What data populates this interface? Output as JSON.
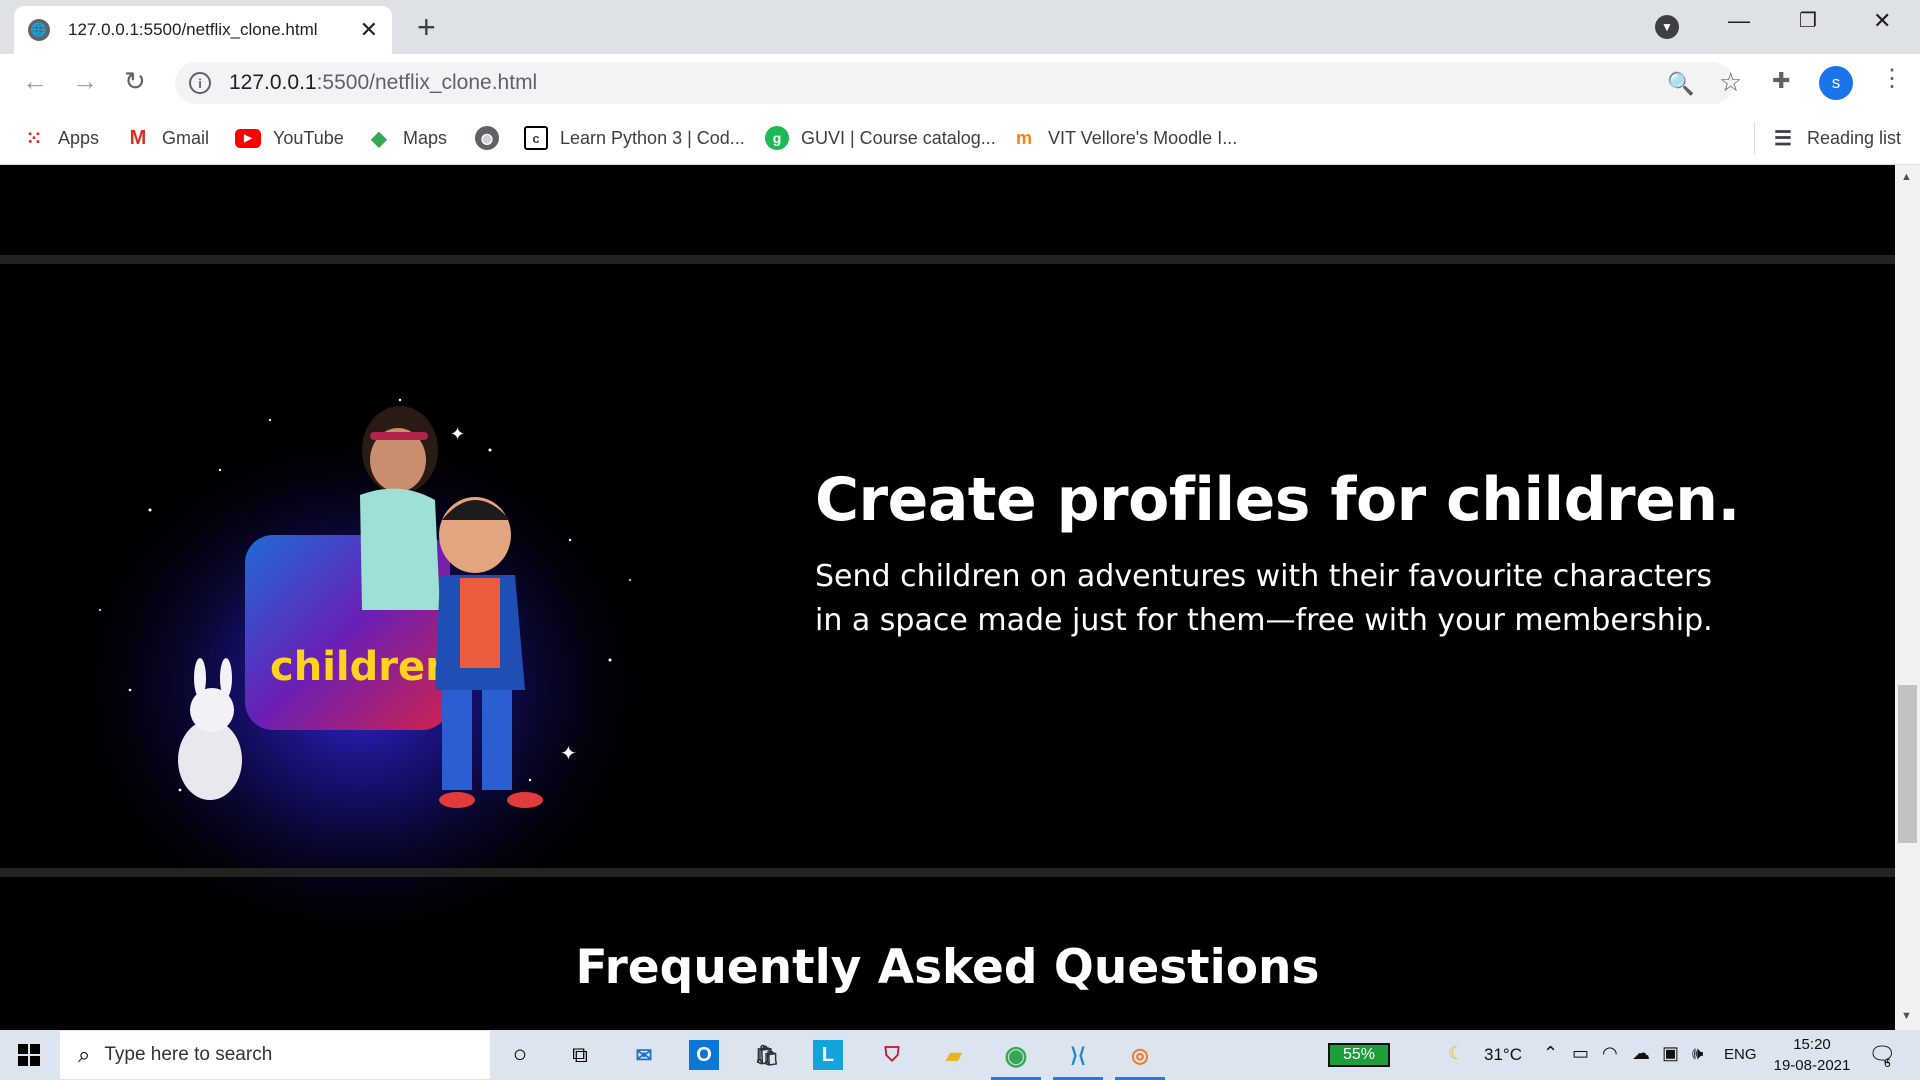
{
  "browser": {
    "tab_title": "127.0.0.1:5500/netflix_clone.html",
    "close_tab": "✕",
    "new_tab": "+",
    "url_host": "127.0.0.1",
    "url_rest": ":5500/netflix_clone.html",
    "profile_initial": "s"
  },
  "bookmarks": [
    {
      "label": "Apps",
      "icon": "apps-grid-icon"
    },
    {
      "label": "Gmail",
      "icon": "gmail-icon"
    },
    {
      "label": "YouTube",
      "icon": "youtube-icon"
    },
    {
      "label": "Maps",
      "icon": "maps-icon"
    },
    {
      "label": "",
      "icon": "globe-icon"
    },
    {
      "label": "Learn Python 3 | Cod...",
      "icon": "codecademy-icon"
    },
    {
      "label": "GUVI | Course catalog...",
      "icon": "guvi-icon"
    },
    {
      "label": "VIT Vellore's Moodle I...",
      "icon": "moodle-icon"
    }
  ],
  "reading_list": "Reading list",
  "page": {
    "hero_title": "Create profiles for children.",
    "hero_text": "Send children on adventures with their favourite characters in a space made just for them—free with your membership.",
    "illustration_label": "children",
    "faq_title": "Frequently Asked Questions"
  },
  "taskbar": {
    "search_placeholder": "Type here to search",
    "battery": "55%",
    "temperature": "31°C",
    "language": "ENG",
    "time": "15:20",
    "date": "19-08-2021",
    "notification_count": "6"
  },
  "colors": {
    "page_bg": "#000000",
    "divider": "#222222",
    "chrome_bg": "#dee1e6",
    "accent_blue": "#1a73e8",
    "youtube_red": "#ff0000",
    "guvi_green": "#1db954"
  }
}
